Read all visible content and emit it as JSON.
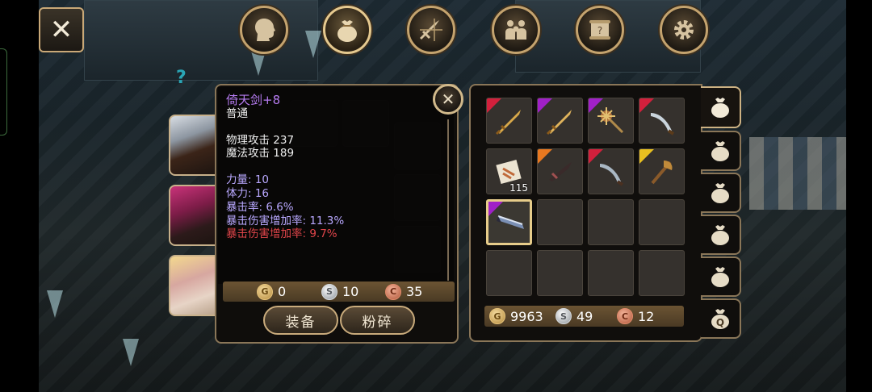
{
  "top_nav": {
    "close_label": "✕",
    "icons": [
      {
        "name": "character-head-icon",
        "active": false
      },
      {
        "name": "bag-icon",
        "active": true
      },
      {
        "name": "skills-sword-icon",
        "active": false
      },
      {
        "name": "party-icon",
        "active": false
      },
      {
        "name": "quest-scroll-icon",
        "active": false
      },
      {
        "name": "settings-gear-icon",
        "active": false
      }
    ]
  },
  "scene": {
    "quest_marker": "?"
  },
  "tooltip": {
    "name": "倚天剑+8",
    "quality": "普通",
    "physical_attack": "物理攻击 237",
    "magic_attack": "魔法攻击 189",
    "stats": [
      {
        "text": "力量: 10",
        "color": "purple"
      },
      {
        "text": "体力: 16",
        "color": "purple"
      },
      {
        "text": "暴击率: 6.6%",
        "color": "purple"
      },
      {
        "text": "暴击伤害增加率: 11.3%",
        "color": "purple"
      },
      {
        "text": "暴击伤害增加率: 9.7%",
        "color": "red"
      }
    ],
    "close_label": "✕",
    "cost": {
      "gold": "0",
      "silver": "10",
      "copper": "35"
    },
    "equip_label": "装备",
    "smash_label": "粉碎"
  },
  "inventory": {
    "items": [
      {
        "name": "golden-sword",
        "rarity": "#d2203c",
        "qty": ""
      },
      {
        "name": "golden-sword-2",
        "rarity": "#a020c8",
        "qty": ""
      },
      {
        "name": "spiked-mace",
        "rarity": "#a020c8",
        "qty": ""
      },
      {
        "name": "curved-dagger",
        "rarity": "#d2203c",
        "qty": ""
      },
      {
        "name": "recipe-scroll",
        "rarity": "",
        "qty": "115"
      },
      {
        "name": "dark-blade",
        "rarity": "#e87820",
        "qty": ""
      },
      {
        "name": "curved-dagger-2",
        "rarity": "#d2203c",
        "qty": ""
      },
      {
        "name": "bronze-axe",
        "rarity": "#e8c020",
        "qty": ""
      },
      {
        "name": "great-sword",
        "rarity": "#a020c8",
        "qty": ""
      },
      {
        "name": "",
        "rarity": "",
        "qty": ""
      },
      {
        "name": "",
        "rarity": "",
        "qty": ""
      },
      {
        "name": "",
        "rarity": "",
        "qty": ""
      },
      {
        "name": "",
        "rarity": "",
        "qty": ""
      },
      {
        "name": "",
        "rarity": "",
        "qty": ""
      },
      {
        "name": "",
        "rarity": "",
        "qty": ""
      },
      {
        "name": "",
        "rarity": "",
        "qty": ""
      }
    ],
    "selected_index": 8,
    "money": {
      "gold": "9963",
      "silver": "49",
      "copper": "12"
    },
    "tabs": [
      "bag-1",
      "bag-2",
      "bag-3",
      "bag-4",
      "bag-5",
      "quest-bag"
    ],
    "quest_tab_label": "Q"
  },
  "coin_glyphs": {
    "gold": "G",
    "silver": "S",
    "copper": "C"
  }
}
